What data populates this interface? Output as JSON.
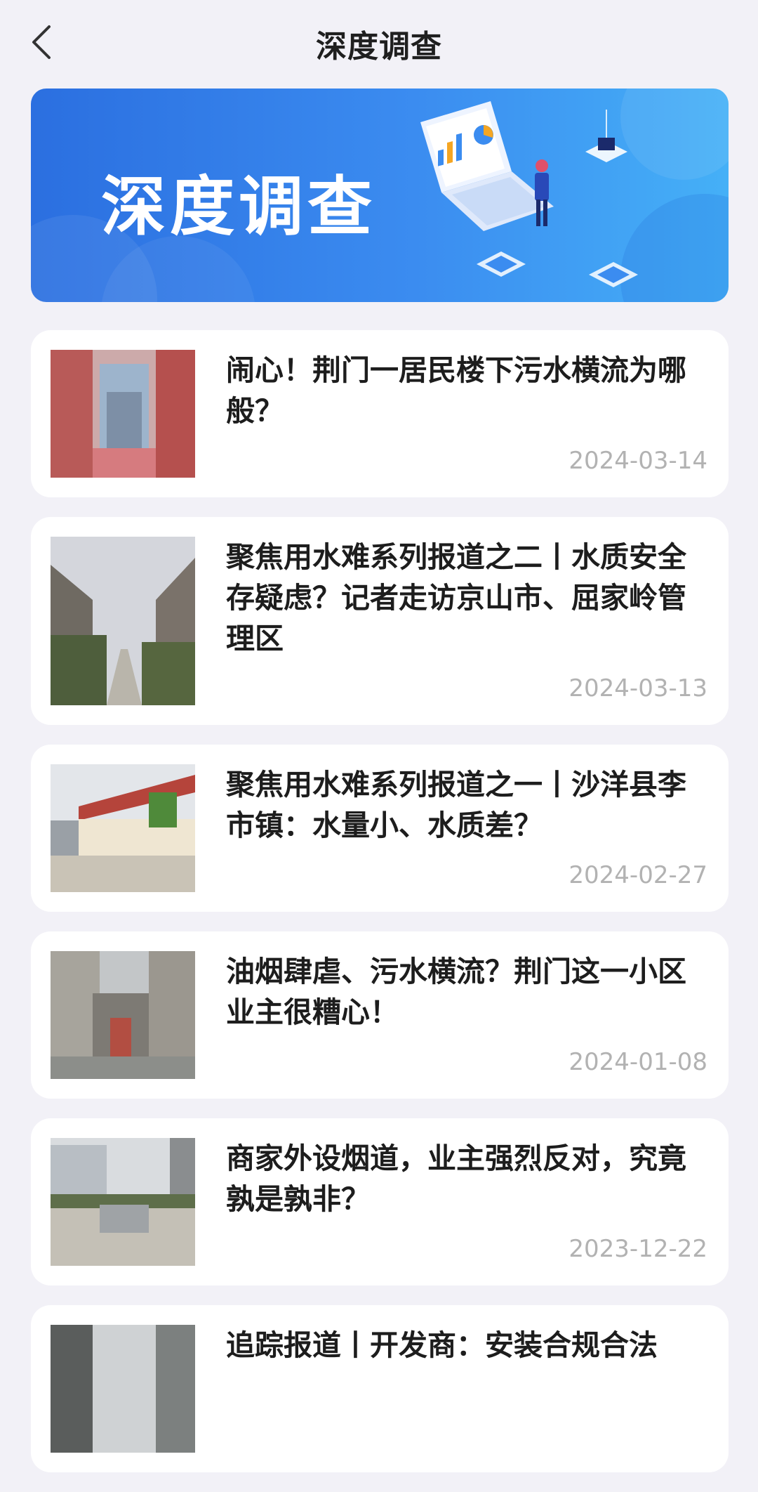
{
  "header": {
    "title": "深度调查"
  },
  "banner": {
    "title": "深度调查"
  },
  "articles": [
    {
      "title": "闹心！荆门一居民楼下污水横流为哪般？",
      "date": "2024-03-14"
    },
    {
      "title": "聚焦用水难系列报道之二丨水质安全存疑虑？记者走访京山市、屈家岭管理区",
      "date": "2024-03-13"
    },
    {
      "title": "聚焦用水难系列报道之一丨沙洋县李市镇：水量小、水质差？",
      "date": "2024-02-27"
    },
    {
      "title": "油烟肆虐、污水横流？荆门这一小区业主很糟心！",
      "date": "2024-01-08"
    },
    {
      "title": "商家外设烟道，业主强烈反对，究竟孰是孰非？",
      "date": "2023-12-22"
    },
    {
      "title": "追踪报道丨开发商：安装合规合法",
      "date": ""
    }
  ],
  "colors": {
    "background": "#f2f1f7",
    "banner_start": "#2b6fe0",
    "banner_end": "#45b0f7",
    "date_text": "#b2b2b2"
  },
  "icons": {
    "back": "chevron-left-icon"
  }
}
